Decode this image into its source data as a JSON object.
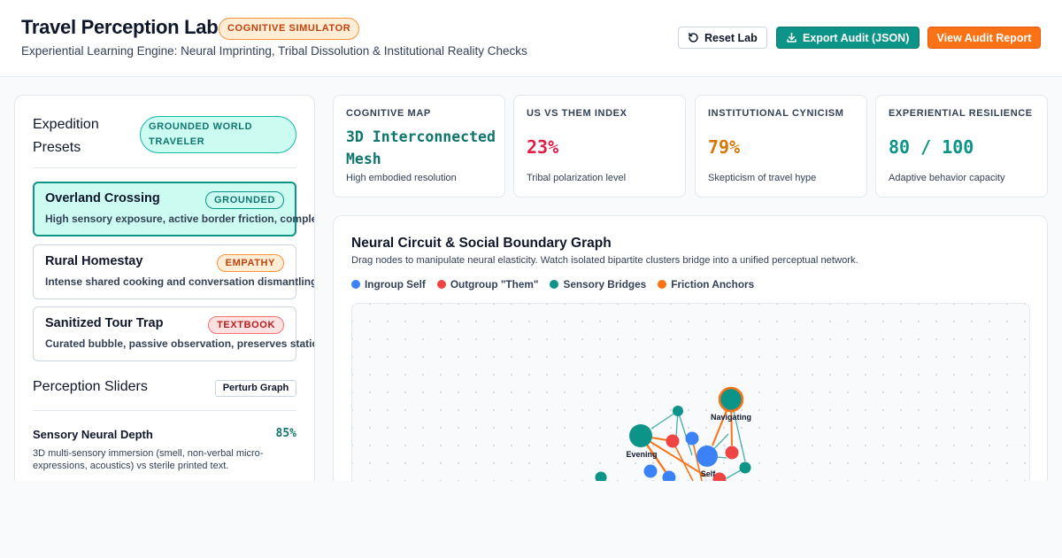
{
  "header": {
    "title": "Travel Perception Lab",
    "mode_badge": "COGNITIVE SIMULATOR",
    "subtitle": "Experiential Learning Engine: Neural Imprinting, Tribal Dissolution & Institutional Reality Checks",
    "buttons": {
      "reset": "Reset Lab",
      "export": "Export Audit (JSON)",
      "report": "View Audit Report"
    }
  },
  "presets": {
    "title": "Expedition Presets",
    "badge": "GROUNDED WORLD TRAVELER",
    "items": [
      {
        "name": "Overland Crossing",
        "tag": "GROUNDED",
        "description": "High sensory exposure, active border friction, complete cultural immersion.",
        "active": true
      },
      {
        "name": "Rural Homestay",
        "tag": "EMPATHY",
        "description": "Intense shared cooking and conversation dismantling tribal boundaries.",
        "active": false
      },
      {
        "name": "Sanitized Tour Trap",
        "tag": "TEXTBOOK",
        "description": "Curated bubble, passive observation, preserves static us-vs-them views.",
        "active": false
      }
    ]
  },
  "sliders": {
    "title": "Perception Sliders",
    "perturb_button": "Perturb Graph",
    "items": [
      {
        "label": "Sensory Neural Depth",
        "value": "85%",
        "description": "3D multi-sensory immersion (smell, non-verbal micro-expressions, acoustics) vs sterile printed text."
      }
    ]
  },
  "metrics": [
    {
      "label": "COGNITIVE MAP",
      "value": "3D Interconnected Mesh",
      "description": "High embodied resolution",
      "color": "#0f766e"
    },
    {
      "label": "US VS THEM INDEX",
      "value": "23%",
      "description": "Tribal polarization level",
      "color": "#e11d48"
    },
    {
      "label": "INSTITUTIONAL CYNICISM",
      "value": "79%",
      "description": "Skepticism of travel hype",
      "color": "#d97706"
    },
    {
      "label": "EXPERIENTIAL RESILIENCE",
      "value": "80 / 100",
      "description": "Adaptive behavior capacity",
      "color": "#0d9488"
    }
  ],
  "graph": {
    "title": "Neural Circuit & Social Boundary Graph",
    "subtitle": "Drag nodes to manipulate neural elasticity. Watch isolated bipartite clusters bridge into a unified perceptual network.",
    "legend": [
      {
        "label": "Ingroup Self",
        "color": "#3b82f6"
      },
      {
        "label": "Outgroup \"Them\"",
        "color": "#ef4444"
      },
      {
        "label": "Sensory Bridges",
        "color": "#0d9488"
      },
      {
        "label": "Friction Anchors",
        "color": "#f97316"
      }
    ],
    "node_labels": {
      "navigating": "Navigating",
      "evening": "Evening",
      "self": "Self"
    }
  }
}
